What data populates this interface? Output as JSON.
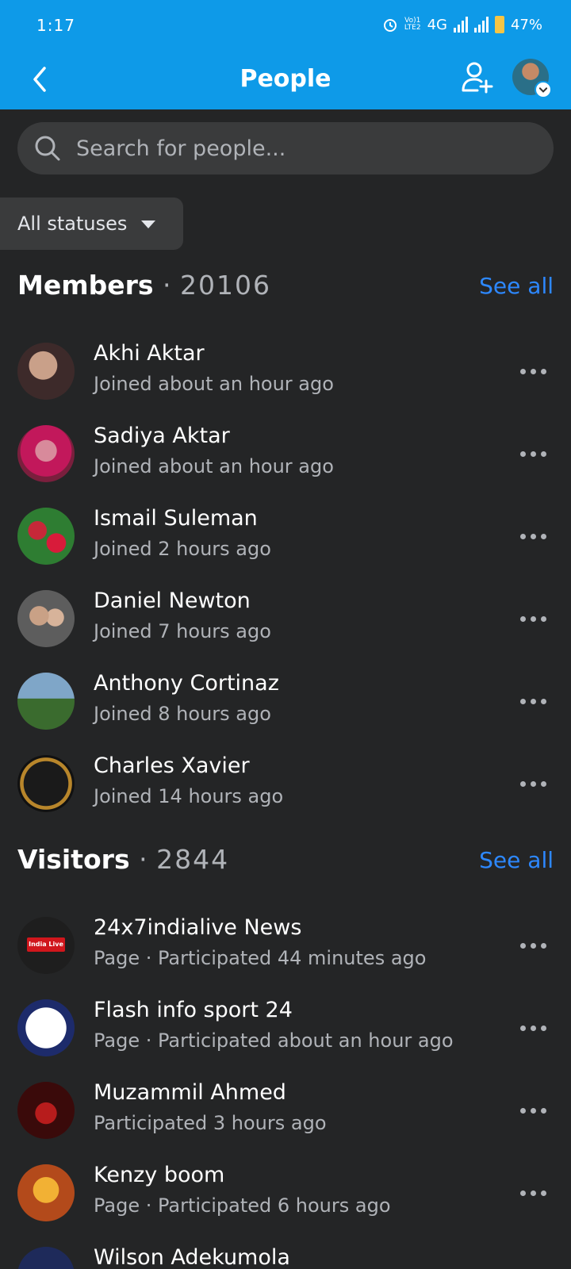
{
  "status_bar": {
    "time": "1:17",
    "network_top": "Vo)1",
    "network_bottom": "LTE2",
    "network": "4G",
    "battery": "47%"
  },
  "header": {
    "title": "People"
  },
  "search": {
    "placeholder": "Search for people..."
  },
  "filter": {
    "label": "All statuses"
  },
  "members": {
    "title": "Members",
    "count": "20106",
    "see_all": "See all",
    "items": [
      {
        "name": "Akhi Aktar",
        "sub": "Joined about an hour ago"
      },
      {
        "name": "Sadiya Aktar",
        "sub": "Joined about an hour ago"
      },
      {
        "name": "Ismail Suleman",
        "sub": "Joined 2 hours ago"
      },
      {
        "name": "Daniel Newton",
        "sub": "Joined 7 hours ago"
      },
      {
        "name": "Anthony Cortinaz",
        "sub": "Joined 8 hours ago"
      },
      {
        "name": "Charles Xavier",
        "sub": "Joined 14 hours ago"
      }
    ]
  },
  "visitors": {
    "title": "Visitors",
    "count": "2844",
    "see_all": "See all",
    "items": [
      {
        "name": "24x7indialive News",
        "sub": "Page · Participated 44 minutes ago",
        "badge": "India Live"
      },
      {
        "name": "Flash info sport 24",
        "sub": "Page · Participated about an hour ago"
      },
      {
        "name": "Muzammil Ahmed",
        "sub": "Participated 3 hours ago"
      },
      {
        "name": "Kenzy boom",
        "sub": "Page · Participated 6 hours ago"
      },
      {
        "name": "Wilson Adekumola",
        "sub": ""
      }
    ]
  },
  "colors": {
    "header": "#0e9ae8",
    "background": "#242526",
    "link": "#2d88ff"
  }
}
